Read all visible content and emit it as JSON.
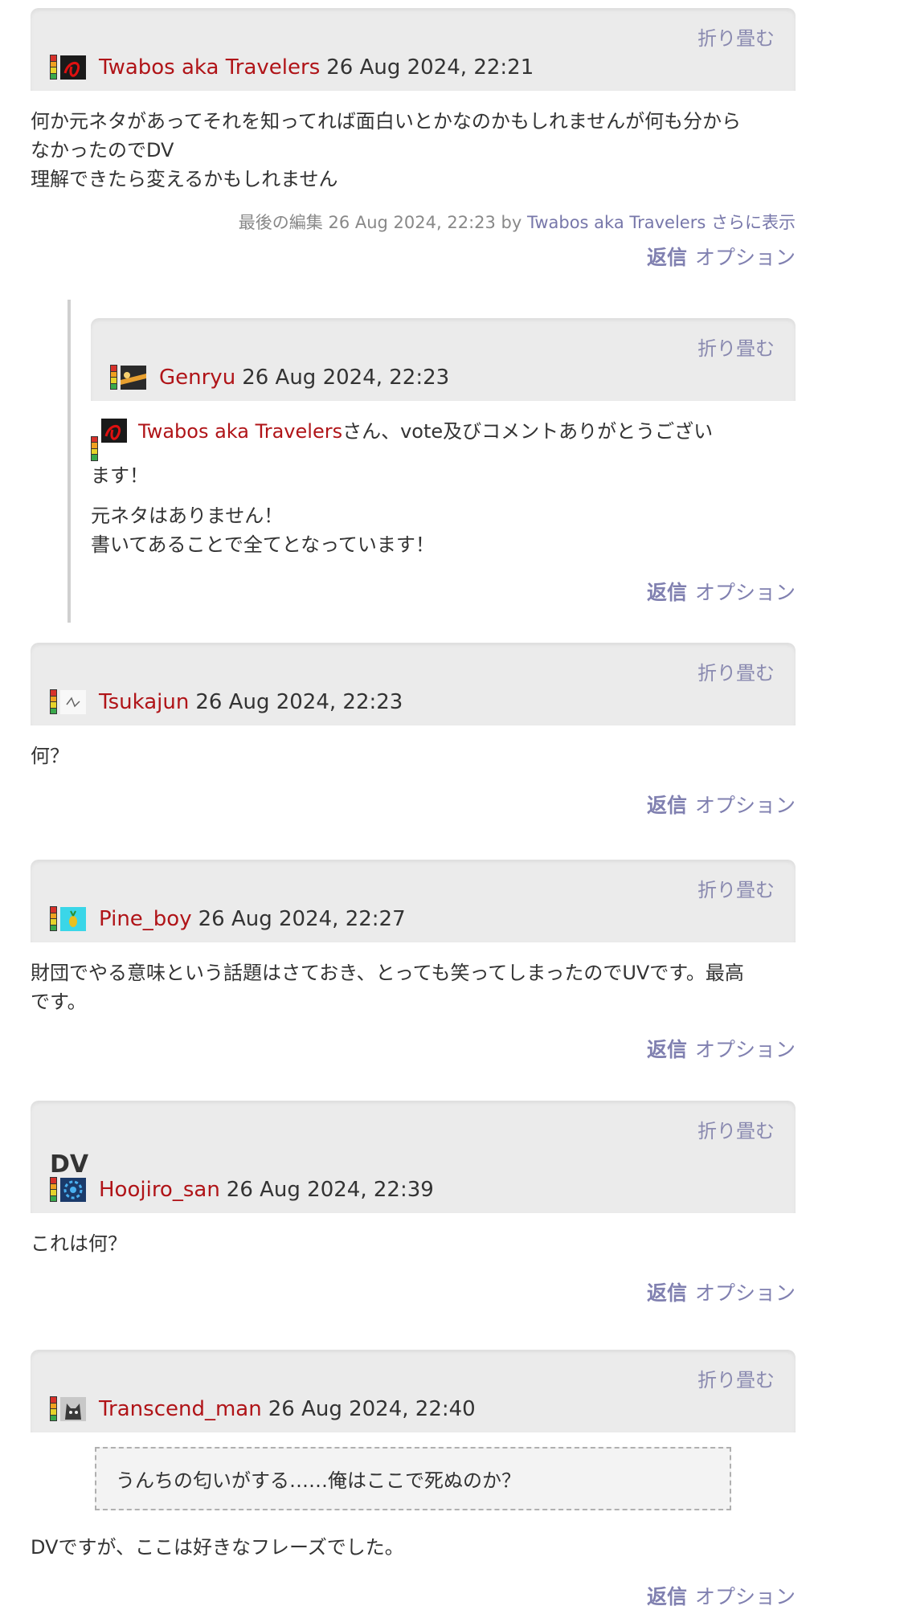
{
  "common": {
    "fold_label": "折り畳む",
    "reply_label": "返信",
    "options_label": "オプション"
  },
  "posts": [
    {
      "user": "Twabos aka Travelers",
      "time": "26 Aug 2024, 22:21",
      "avatar": "red-swirl-icon",
      "lines": [
        "何か元ネタがあってそれを知ってれば面白いとかなのかもしれませんが何も分から",
        "なかったのでDV",
        "理解できたら変えるかもしれません"
      ],
      "edit": {
        "prefix": "最後の編集 26 Aug 2024, 22:23 by",
        "user": "Twabos aka Travelers",
        "more": "さらに表示"
      }
    },
    {
      "user": "Genryu",
      "time": "26 Aug 2024, 22:23",
      "avatar": "sunset-icon",
      "mention_user": "Twabos aka Travelers",
      "mention_rest_1": "さん、vote及びコメントありがとうござい",
      "mention_rest_2": "ます！",
      "lines": [
        "元ネタはありません！",
        "書いてあることで全てとなっています！"
      ]
    },
    {
      "user": "Tsukajun",
      "time": "26 Aug 2024, 22:23",
      "avatar": "sketch-icon",
      "lines": [
        "何？"
      ]
    },
    {
      "user": "Pine_boy",
      "time": "26 Aug 2024, 22:27",
      "avatar": "pineapple-icon",
      "lines": [
        "財団でやる意味という話題はさておき、とっても笑ってしまったのでUVです。最高",
        "です。"
      ]
    },
    {
      "user": "Hoojiro_san",
      "time": "26 Aug 2024, 22:39",
      "avatar": "blue-gear-icon",
      "vote": "DV",
      "lines": [
        "これは何？"
      ]
    },
    {
      "user": "Transcend_man",
      "time": "26 Aug 2024, 22:40",
      "avatar": "cat-icon",
      "quote": "うんちの匂いがする……俺はここで死ぬのか？",
      "lines": [
        "DVですが、ここは好きなフレーズでした。"
      ]
    }
  ]
}
